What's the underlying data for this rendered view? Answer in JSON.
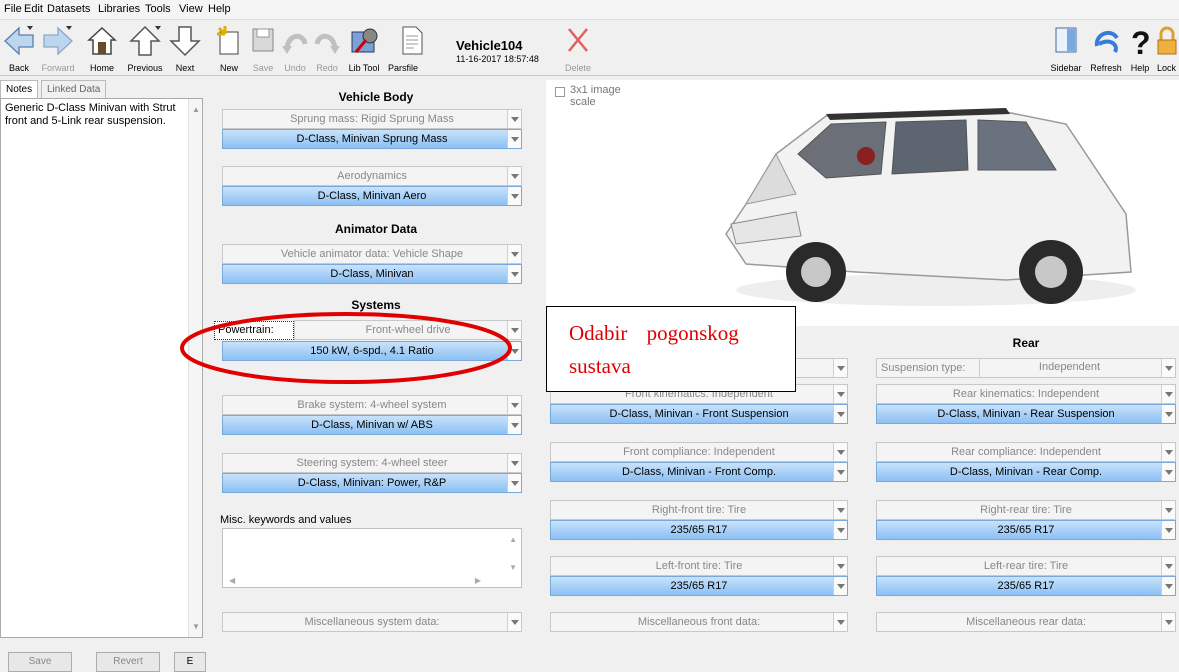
{
  "menu": [
    "File",
    "Edit",
    "Datasets",
    "Libraries",
    "Tools",
    "View",
    "Help"
  ],
  "toolbar": {
    "back": "Back",
    "forward": "Forward",
    "home": "Home",
    "previous": "Previous",
    "next": "Next",
    "new": "New",
    "save": "Save",
    "undo": "Undo",
    "redo": "Redo",
    "libtool": "Lib Tool",
    "parsfile": "Parsfile",
    "dataset_title": "Vehicle104",
    "dataset_date": "11-16-2017 18:57:48",
    "delete": "Delete",
    "sidebar": "Sidebar",
    "refresh": "Refresh",
    "help": "Help",
    "lock": "Lock"
  },
  "left": {
    "tab_notes": "Notes",
    "tab_linked": "Linked Data",
    "notes": "Generic D-Class Minivan with Strut front and 5-Link rear suspension.",
    "save": "Save",
    "revert": "Revert",
    "third_button": "E"
  },
  "vehicle_body": {
    "heading": "Vehicle Body",
    "sprung_label": "Sprung mass: Rigid Sprung Mass",
    "sprung_value": "D-Class, Minivan Sprung Mass",
    "aero_label": "Aerodynamics",
    "aero_value": "D-Class, Minivan Aero"
  },
  "animator": {
    "heading": "Animator Data",
    "shape_label": "Vehicle animator data: Vehicle Shape",
    "shape_value": "D-Class, Minivan"
  },
  "systems": {
    "heading": "Systems",
    "powertrain_label": "Powertrain:",
    "powertrain_type": "Front-wheel drive",
    "powertrain_value": "150 kW, 6-spd., 4.1 Ratio",
    "brake_label": "Brake system: 4-wheel system",
    "brake_value": "D-Class, Minivan w/ ABS",
    "steer_label": "Steering system: 4-wheel steer",
    "steer_value": "D-Class, Minivan: Power, R&P",
    "misc_keywords": "Misc. keywords and values",
    "misc_system": "Miscellaneous system data:"
  },
  "image": {
    "checkbox_label": "3x1 image scale"
  },
  "annotation": {
    "text_line1": "Odabir pogonskog",
    "text_line2": "sustava",
    "color": "#e00000"
  },
  "front": {
    "kin_label": "Front kinematics: Independent",
    "kin_value": "D-Class, Minivan - Front Suspension",
    "comp_label": "Front compliance: Independent",
    "comp_value": "D-Class, Minivan - Front Comp.",
    "rtire_label": "Right-front tire: Tire",
    "rtire_value": "235/65 R17",
    "ltire_label": "Left-front tire: Tire",
    "ltire_value": "235/65 R17",
    "misc": "Miscellaneous front data:"
  },
  "rear": {
    "heading": "Rear",
    "susp_label": "Suspension type:",
    "susp_value": "Independent",
    "kin_label": "Rear kinematics: Independent",
    "kin_value": "D-Class, Minivan - Rear Suspension",
    "comp_label": "Rear compliance: Independent",
    "comp_value": "D-Class, Minivan - Rear Comp.",
    "rtire_label": "Right-rear tire: Tire",
    "rtire_value": "235/65 R17",
    "ltire_label": "Left-rear tire: Tire",
    "ltire_value": "235/65 R17",
    "misc": "Miscellaneous rear data:"
  }
}
